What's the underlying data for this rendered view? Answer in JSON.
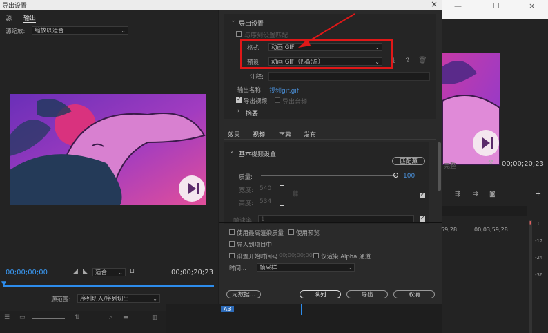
{
  "window": {
    "title": "导出设置",
    "close_glyph": "×"
  },
  "right_window_controls": {
    "minimize": "—",
    "maximize": "☐",
    "close": "×"
  },
  "left": {
    "tabs": [
      "源",
      "输出"
    ],
    "source_scale_label": "源缩放:",
    "source_scale_value": "缩放以适合",
    "timecode_start": "00;00;00;00",
    "timecode_end": "00;00;20;23",
    "fit_value": "适合",
    "range_label": "源范围:",
    "range_value": "序列切入/序列切出"
  },
  "export_settings": {
    "section_title": "导出设置",
    "match_sequence_label": "与序列设置匹配",
    "format_label": "格式:",
    "format_value": "动画 GIF",
    "preset_label": "预设:",
    "preset_value": "动画 GIF（匹配源）",
    "comments_label": "注释:",
    "output_name_label": "输出名称:",
    "output_name_value": "视频gif.gif",
    "export_video_label": "导出视频",
    "export_audio_label": "导出音频",
    "summary_label": "摘要"
  },
  "tabs2": [
    "效果",
    "视频",
    "字幕",
    "发布"
  ],
  "video": {
    "section_title": "基本视频设置",
    "match_source_button": "匹配源",
    "quality_label": "质量:",
    "quality_value": "100",
    "width_label": "宽度:",
    "width_value": "540",
    "height_label": "高度:",
    "height_value": "534",
    "frame_rate_label": "帧速率:",
    "frame_rate_value": "1"
  },
  "bottom": {
    "max_render_label": "使用最高渲染质量",
    "use_previews_label": "使用预览",
    "import_project_label": "导入到项目中",
    "set_start_tc_label": "设置开始时间码",
    "start_tc_value": "00;00;00;00",
    "alpha_only_label": "仅渲染 Alpha 通道",
    "time_interp_label": "时间...",
    "time_interp_value": "帧采样",
    "metadata_button": "元数据...",
    "queue_button": "队列",
    "export_button": "导出",
    "cancel_button": "取消"
  },
  "right": {
    "timecode": "00;00;20;23",
    "complete_label": "完整",
    "ruler_1": "59;28",
    "ruler_2": "00;03;59;28",
    "meter_ticks": [
      "0",
      "-12",
      "-24",
      "-36"
    ],
    "track_label": "A3",
    "plus_glyph": "+"
  },
  "colors": {
    "accent_blue": "#2d8ceb",
    "highlight_red": "#e01818",
    "arrow_red": "#e01818"
  }
}
